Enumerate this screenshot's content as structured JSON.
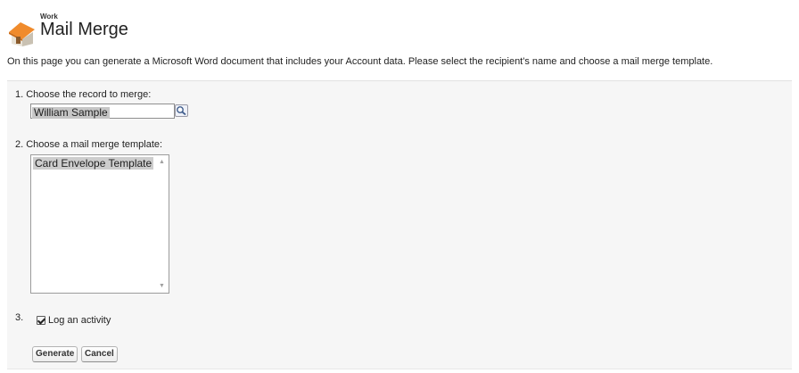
{
  "header": {
    "breadcrumb": "Work",
    "title": "Mail Merge"
  },
  "description": "On this page you can generate a Microsoft Word document that includes your Account data. Please select the recipient's name and choose a mail merge template.",
  "step1": {
    "label": "1. Choose the record to merge:",
    "value": "William Sample",
    "lookup_icon": "lookup-icon"
  },
  "step2": {
    "label": "2. Choose a mail merge template:",
    "options": [
      "Card Envelope Template"
    ],
    "selected": "Card Envelope Template"
  },
  "step3": {
    "number": "3.",
    "checkbox_label": "Log an activity",
    "checked": true
  },
  "buttons": {
    "generate": "Generate",
    "cancel": "Cancel"
  },
  "colors": {
    "panel_bg": "#f6f6f6",
    "selection": "#c6c6c6",
    "house_roof": "#f08b2c"
  }
}
